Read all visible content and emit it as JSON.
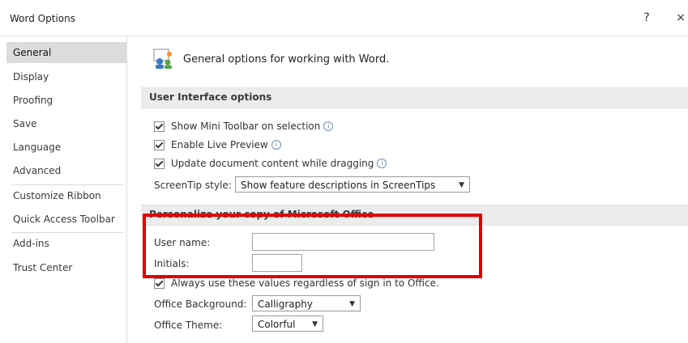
{
  "window": {
    "title": "Word Options",
    "help_label": "?",
    "close_label": "×"
  },
  "sidebar": {
    "items": [
      {
        "label": "General",
        "selected": true
      },
      {
        "label": "Display"
      },
      {
        "label": "Proofing"
      },
      {
        "label": "Save"
      },
      {
        "label": "Language"
      },
      {
        "label": "Advanced"
      },
      {
        "label": "Customize Ribbon"
      },
      {
        "label": "Quick Access Toolbar"
      },
      {
        "label": "Add-ins"
      },
      {
        "label": "Trust Center"
      }
    ]
  },
  "main": {
    "header": "General options for working with Word.",
    "ui_section": {
      "title": "User Interface options",
      "options": [
        {
          "label": "Show Mini Toolbar on selection",
          "checked": true,
          "info": true
        },
        {
          "label": "Enable Live Preview",
          "checked": true,
          "info": true
        },
        {
          "label": "Update document content while dragging",
          "checked": true,
          "info": true
        }
      ],
      "screentip_label": "ScreenTip style:",
      "screentip_value": "Show feature descriptions in ScreenTips"
    },
    "personalize_section": {
      "title": "Personalize your copy of Microsoft Office",
      "user_name_label": "User name:",
      "user_name_value": "",
      "initials_label": "Initials:",
      "initials_value": "",
      "always_use_label": "Always use these values regardless of sign in to Office.",
      "office_background_label": "Office Background:",
      "office_background_value": "Calligraphy",
      "office_theme_label": "Office Theme:",
      "office_theme_value": "Colorful"
    }
  },
  "colors": {
    "highlight": "#e00000",
    "selected_nav": "#dcdcdc",
    "section_bg": "#ececec"
  }
}
